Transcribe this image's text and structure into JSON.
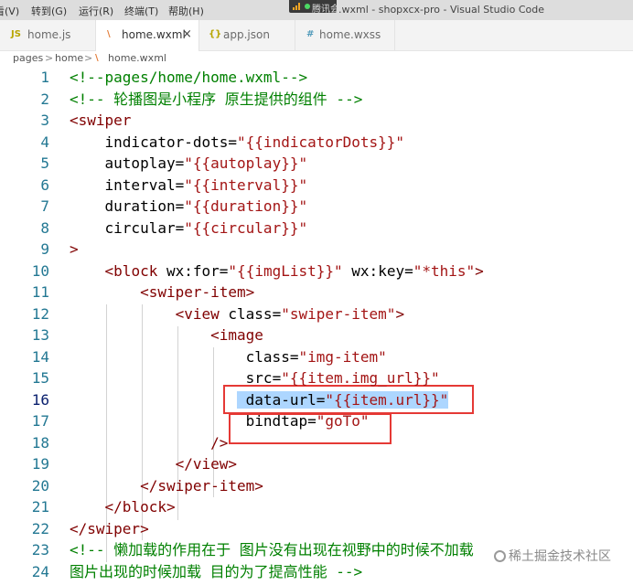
{
  "menu": {
    "items": [
      "看(V)",
      "转到(G)",
      "运行(R)",
      "终端(T)",
      "帮助(H)"
    ]
  },
  "meeting_badge": {
    "label": "腾讯会议"
  },
  "window_title": ".wxml - shopxcx-pro - Visual Studio Code",
  "tabs": [
    {
      "icon": "JS",
      "label": "home.js"
    },
    {
      "icon": "\\",
      "label": "home.wxml",
      "close": "×"
    },
    {
      "icon": "{}",
      "label": "app.json"
    },
    {
      "icon": "#",
      "label": "home.wxss"
    }
  ],
  "breadcrumb": {
    "parts": [
      "pages",
      "home",
      "home.wxml"
    ],
    "separator": ">"
  },
  "code_lines": [
    {
      "n": "1",
      "tokens": [
        [
          "comment",
          "<!--pages/home/home.wxml-->"
        ]
      ]
    },
    {
      "n": "2",
      "tokens": [
        [
          "comment",
          "<!-- 轮播图是小程序 原生提供的组件 -->"
        ]
      ]
    },
    {
      "n": "3",
      "tokens": [
        [
          "punct",
          "<"
        ],
        [
          "tag",
          "swiper"
        ]
      ]
    },
    {
      "n": "4",
      "tokens": [
        [
          "attr",
          "    indicator-dots"
        ],
        [
          "eq",
          "="
        ],
        [
          "str",
          "\"{{indicatorDots}}\""
        ]
      ]
    },
    {
      "n": "5",
      "tokens": [
        [
          "attr",
          "    autoplay"
        ],
        [
          "eq",
          "="
        ],
        [
          "str",
          "\"{{autoplay}}\""
        ]
      ]
    },
    {
      "n": "6",
      "tokens": [
        [
          "attr",
          "    interval"
        ],
        [
          "eq",
          "="
        ],
        [
          "str",
          "\"{{interval}}\""
        ]
      ]
    },
    {
      "n": "7",
      "tokens": [
        [
          "attr",
          "    duration"
        ],
        [
          "eq",
          "="
        ],
        [
          "str",
          "\"{{duration}}\""
        ]
      ]
    },
    {
      "n": "8",
      "tokens": [
        [
          "attr",
          "    circular"
        ],
        [
          "eq",
          "="
        ],
        [
          "str",
          "\"{{circular}}\""
        ]
      ]
    },
    {
      "n": "9",
      "tokens": [
        [
          "punct",
          ">"
        ]
      ]
    },
    {
      "n": "10",
      "tokens": [
        [
          "text",
          "    "
        ],
        [
          "punct",
          "<"
        ],
        [
          "tag",
          "block"
        ],
        [
          "attr",
          " wx:for"
        ],
        [
          "eq",
          "="
        ],
        [
          "str",
          "\"{{imgList}}\""
        ],
        [
          "attr",
          " wx:key"
        ],
        [
          "eq",
          "="
        ],
        [
          "str",
          "\"*this\""
        ],
        [
          "punct",
          ">"
        ]
      ]
    },
    {
      "n": "11",
      "tokens": [
        [
          "text",
          "        "
        ],
        [
          "punct",
          "<"
        ],
        [
          "tag",
          "swiper-item"
        ],
        [
          "punct",
          ">"
        ]
      ]
    },
    {
      "n": "12",
      "tokens": [
        [
          "text",
          "            "
        ],
        [
          "punct",
          "<"
        ],
        [
          "tag",
          "view"
        ],
        [
          "attr",
          " class"
        ],
        [
          "eq",
          "="
        ],
        [
          "str",
          "\"swiper-item\""
        ],
        [
          "punct",
          ">"
        ]
      ]
    },
    {
      "n": "13",
      "tokens": [
        [
          "text",
          "                "
        ],
        [
          "punct",
          "<"
        ],
        [
          "tag",
          "image"
        ]
      ]
    },
    {
      "n": "14",
      "tokens": [
        [
          "attr",
          "                    class"
        ],
        [
          "eq",
          "="
        ],
        [
          "str",
          "\"img-item\""
        ]
      ]
    },
    {
      "n": "15",
      "tokens": [
        [
          "attr",
          "                    src"
        ],
        [
          "eq",
          "="
        ],
        [
          "str",
          "\"{{item.img_url}}\""
        ]
      ]
    },
    {
      "n": "16",
      "current": true,
      "tokens": [
        [
          "text",
          "                   "
        ],
        [
          "selattr",
          " data-url"
        ],
        [
          "seleq",
          "="
        ],
        [
          "selstr",
          "\"{{item.url}}\""
        ]
      ]
    },
    {
      "n": "17",
      "tokens": [
        [
          "attr",
          "                    bindtap"
        ],
        [
          "eq",
          "="
        ],
        [
          "str",
          "\"goTo\""
        ]
      ]
    },
    {
      "n": "18",
      "tokens": [
        [
          "text",
          "                "
        ],
        [
          "punct",
          "/>"
        ]
      ]
    },
    {
      "n": "19",
      "tokens": [
        [
          "text",
          "            "
        ],
        [
          "punct",
          "</"
        ],
        [
          "tag",
          "view"
        ],
        [
          "punct",
          ">"
        ]
      ]
    },
    {
      "n": "20",
      "tokens": [
        [
          "text",
          "        "
        ],
        [
          "punct",
          "</"
        ],
        [
          "tag",
          "swiper-item"
        ],
        [
          "punct",
          ">"
        ]
      ]
    },
    {
      "n": "21",
      "tokens": [
        [
          "text",
          "    "
        ],
        [
          "punct",
          "</"
        ],
        [
          "tag",
          "block"
        ],
        [
          "punct",
          ">"
        ]
      ]
    },
    {
      "n": "22",
      "tokens": [
        [
          "punct",
          "</"
        ],
        [
          "tag",
          "swiper"
        ],
        [
          "punct",
          ">"
        ]
      ]
    },
    {
      "n": "23",
      "tokens": [
        [
          "comment",
          "<!-- 懒加载的作用在于 图片没有出现在视野中的时候不加载"
        ]
      ]
    },
    {
      "n": "24",
      "tokens": [
        [
          "comment",
          "图片出现的时候加载 目的为了提高性能 -->"
        ]
      ]
    }
  ],
  "watermark": "稀土掘金技术社区",
  "colors": {
    "comment": "#008000",
    "tag": "#800000",
    "string": "#a31515",
    "line_number": "#237893",
    "selection": "#add6ff",
    "highlight_box": "#e53935"
  }
}
